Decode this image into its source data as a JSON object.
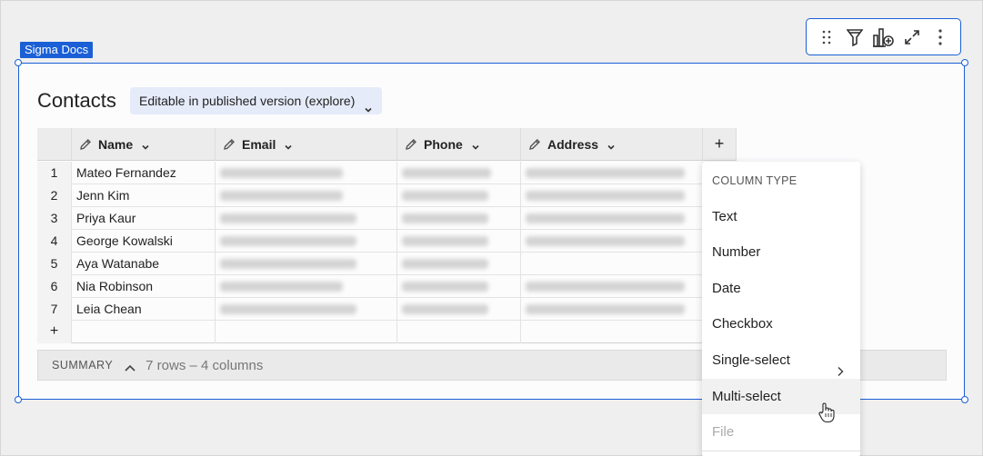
{
  "element_tag": "Sigma Docs",
  "toolbar": {
    "icons": [
      "drag-handle-icon",
      "filter-icon",
      "add-chart-icon",
      "expand-icon",
      "more-icon"
    ]
  },
  "table": {
    "title": "Contacts",
    "mode_label": "Editable in published version (explore)",
    "columns": [
      "Name",
      "Email",
      "Phone",
      "Address"
    ],
    "add_column_label": "+",
    "add_row_label": "+",
    "rows": [
      {
        "num": "1",
        "name": "Mateo Fernandez"
      },
      {
        "num": "2",
        "name": "Jenn Kim"
      },
      {
        "num": "3",
        "name": "Priya Kaur"
      },
      {
        "num": "4",
        "name": "George Kowalski"
      },
      {
        "num": "5",
        "name": "Aya Watanabe"
      },
      {
        "num": "6",
        "name": "Nia Robinson"
      },
      {
        "num": "7",
        "name": "Leia Chean"
      }
    ]
  },
  "summary": {
    "label": "SUMMARY",
    "text": "7 rows – 4 columns"
  },
  "column_type_menu": {
    "heading": "COLUMN TYPE",
    "items": [
      {
        "label": "Text"
      },
      {
        "label": "Number"
      },
      {
        "label": "Date"
      },
      {
        "label": "Checkbox"
      },
      {
        "label": "Single-select"
      },
      {
        "label": "Multi-select"
      },
      {
        "label": "File"
      }
    ]
  },
  "colors": {
    "accent": "#1a5fd6",
    "pill_bg": "#e6ebfa"
  }
}
